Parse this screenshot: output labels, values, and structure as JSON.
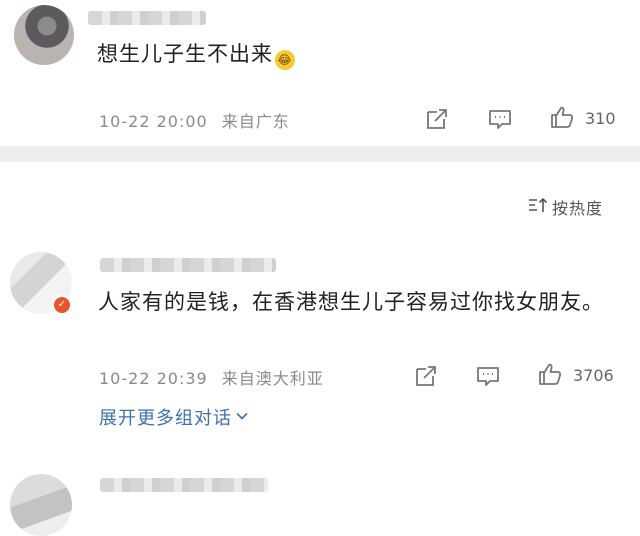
{
  "comments": [
    {
      "text": "想生儿子生不出来",
      "emoji": "laughing-crying-emoji",
      "date": "10-22 20:00",
      "location": "来自广东",
      "likes": "310"
    },
    {
      "text": "人家有的是钱，在香港想生儿子容易过你找女朋友。",
      "date": "10-22 20:39",
      "location": "来自澳大利亚",
      "likes": "3706",
      "expand_label": "展开更多组对话"
    }
  ],
  "sort": {
    "label": "按热度"
  },
  "colors": {
    "link": "#3f6fb0",
    "divider": "#eeeeee",
    "meta_text": "#8a8a8a",
    "badge": "#e8552b"
  }
}
